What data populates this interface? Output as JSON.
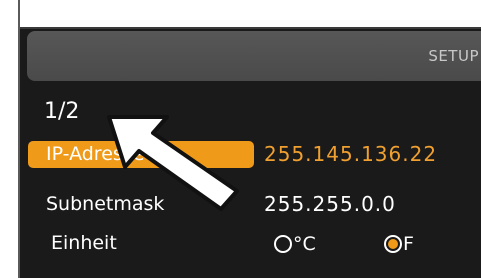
{
  "header": {
    "title": "SETUP"
  },
  "page_indicator": "1/2",
  "rows": [
    {
      "label": "IP-Adresse",
      "value": "255.145.136.22",
      "selected": true
    },
    {
      "label": "Subnetmask",
      "value": "255.255.0.0"
    }
  ],
  "unit": {
    "label": "Einheit",
    "options": [
      {
        "label": "°C",
        "checked": false
      },
      {
        "label": "F",
        "checked": true
      }
    ]
  },
  "colors": {
    "accent": "#f09a1a",
    "background": "#1a1a1a",
    "header": "#505050"
  }
}
